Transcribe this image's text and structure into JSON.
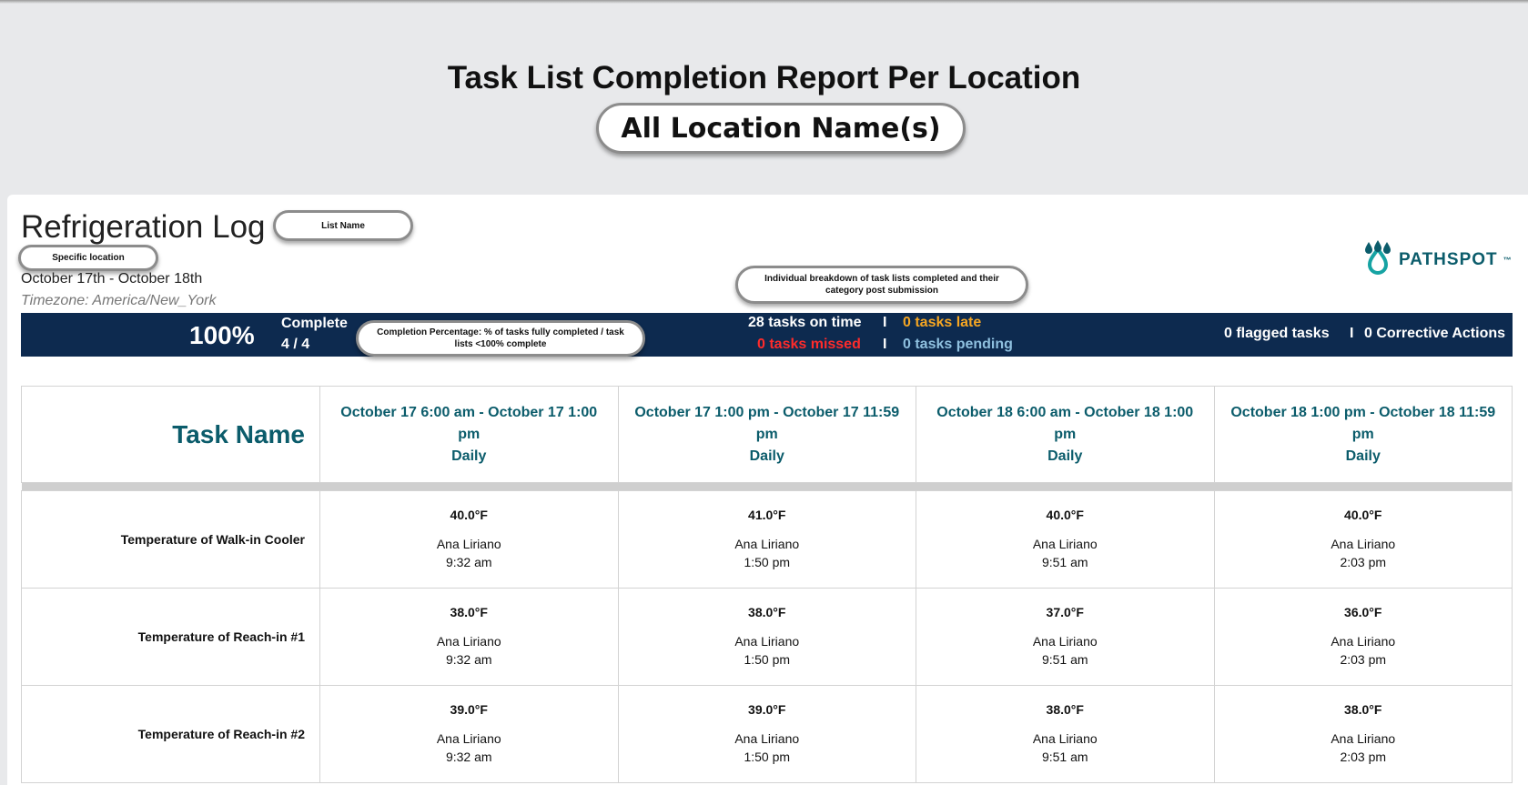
{
  "report": {
    "title": "Task List Completion Report Per Location",
    "locations_pill": "All Location Name(s)"
  },
  "list": {
    "title": "Refrigeration Log",
    "list_name_pill": "List Name",
    "location_pill": "Specific location",
    "date_range": "October 17th - October 18th",
    "timezone": "Timezone: America/New_York",
    "breakdown_pill": "Individual breakdown of task lists completed and their category post submission"
  },
  "logo": {
    "text": "PATHSPOT",
    "trademark": "™",
    "icon": "water-drops-logo-icon"
  },
  "summary": {
    "percentage": "100%",
    "complete_label": "Complete",
    "complete_count": "4 / 4",
    "completion_pill": "Completion Percentage:  % of tasks fully completed / task lists <100% complete",
    "on_time": "28 tasks on time",
    "late": "0 tasks late",
    "missed": "0 tasks missed",
    "pending": "0 tasks pending",
    "separator": "I",
    "flagged": "0 flagged tasks",
    "corrective": "0 Corrective Actions",
    "colors": {
      "bar": "#0d2a4f",
      "late": "#f5a623",
      "missed": "#ff2b2b",
      "pending": "#8fc0df"
    }
  },
  "table": {
    "task_header": "Task Name",
    "columns": [
      {
        "range": "October 17 6:00 am - October 17 1:00 pm",
        "freq": "Daily"
      },
      {
        "range": "October 17 1:00 pm - October 17 11:59 pm",
        "freq": "Daily"
      },
      {
        "range": "October 18 6:00 am - October 18 1:00 pm",
        "freq": "Daily"
      },
      {
        "range": "October 18 1:00 pm - October 18 11:59 pm",
        "freq": "Daily"
      }
    ],
    "rows": [
      {
        "task": "Temperature of Walk-in Cooler",
        "cells": [
          {
            "value": "40.0°F",
            "who": "Ana Liriano",
            "time": "9:32 am"
          },
          {
            "value": "41.0°F",
            "who": "Ana Liriano",
            "time": "1:50 pm"
          },
          {
            "value": "40.0°F",
            "who": "Ana Liriano",
            "time": "9:51 am"
          },
          {
            "value": "40.0°F",
            "who": "Ana Liriano",
            "time": "2:03 pm"
          }
        ]
      },
      {
        "task": "Temperature of Reach-in #1",
        "cells": [
          {
            "value": "38.0°F",
            "who": "Ana Liriano",
            "time": "9:32 am"
          },
          {
            "value": "38.0°F",
            "who": "Ana Liriano",
            "time": "1:50 pm"
          },
          {
            "value": "37.0°F",
            "who": "Ana Liriano",
            "time": "9:51 am"
          },
          {
            "value": "36.0°F",
            "who": "Ana Liriano",
            "time": "2:03 pm"
          }
        ]
      },
      {
        "task": "Temperature of Reach-in #2",
        "cells": [
          {
            "value": "39.0°F",
            "who": "Ana Liriano",
            "time": "9:32 am"
          },
          {
            "value": "39.0°F",
            "who": "Ana Liriano",
            "time": "1:50 pm"
          },
          {
            "value": "38.0°F",
            "who": "Ana Liriano",
            "time": "9:51 am"
          },
          {
            "value": "38.0°F",
            "who": "Ana Liriano",
            "time": "2:03 pm"
          }
        ]
      }
    ]
  }
}
